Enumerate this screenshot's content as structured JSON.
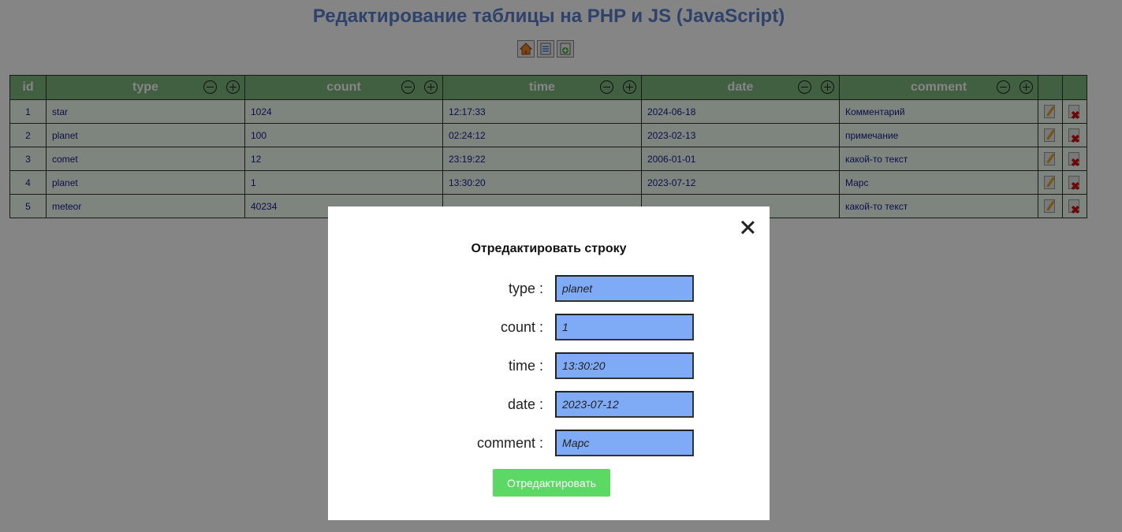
{
  "page": {
    "title": "Редактирование таблицы на PHP и JS (JavaScript)"
  },
  "toolbar": {
    "icons": [
      "home-icon",
      "export-icon",
      "add-icon"
    ]
  },
  "table": {
    "headers": [
      "id",
      "type",
      "count",
      "time",
      "date",
      "comment"
    ],
    "rows": [
      {
        "id": "1",
        "type": "star",
        "count": "1024",
        "time": "12:17:33",
        "date": "2024-06-18",
        "comment": "Комментарий"
      },
      {
        "id": "2",
        "type": "planet",
        "count": "100",
        "time": "02:24:12",
        "date": "2023-02-13",
        "comment": "примечание"
      },
      {
        "id": "3",
        "type": "comet",
        "count": "12",
        "time": "23:19:22",
        "date": "2006-01-01",
        "comment": "какой-то текст"
      },
      {
        "id": "4",
        "type": "planet",
        "count": "1",
        "time": "13:30:20",
        "date": "2023-07-12",
        "comment": "Марс"
      },
      {
        "id": "5",
        "type": "meteor",
        "count": "40234",
        "time": "",
        "date": "",
        "comment": "какой-то текст"
      }
    ]
  },
  "modal": {
    "title": "Отредактировать строку",
    "fields": [
      {
        "label": "type :",
        "value": "planet"
      },
      {
        "label": "count :",
        "value": "1"
      },
      {
        "label": "time :",
        "value": "13:30:20"
      },
      {
        "label": "date :",
        "value": "2023-07-12"
      },
      {
        "label": "comment :",
        "value": "Марс"
      }
    ],
    "submit_label": "Отредактировать"
  },
  "colors": {
    "title": "#5b7fcb",
    "header_bg": "#7eb67e",
    "cell_bg": "#f2fff2",
    "input_bg": "#7faaf5",
    "submit_bg": "#5cd865"
  }
}
